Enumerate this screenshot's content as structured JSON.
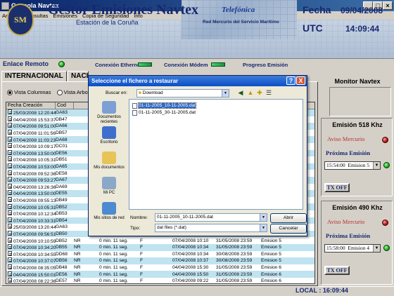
{
  "window": {
    "title": "Consola Navtex"
  },
  "menu": [
    "Archivo",
    "Consultas",
    "Emisiones",
    "Copia de Seguridad",
    "Info"
  ],
  "header": {
    "logo_text": "SM",
    "title": "Gestor Emisiones Navtex",
    "subtitle": "Estación de la Coruña",
    "brand": "Telefónica",
    "network": "Red Mercurio del Servicio Marítimo",
    "fecha_label": "Fecha",
    "fecha_value": "09/04/2008",
    "utc_label": "UTC",
    "utc_value": "14:09:44"
  },
  "status": {
    "enlace_label": "Enlace Remoto",
    "ethernet_label": "Conexión Ethernet",
    "modem_label": "Conexión Módem",
    "progreso_label": "Progreso Emisión"
  },
  "tabs": [
    "INTERNACIONAL",
    "NACI"
  ],
  "view": {
    "columns_label": "Vista Columnas",
    "tree_label": "Vista Arbol"
  },
  "table": {
    "headers": [
      "Fecha Creación",
      "Cod Nx"
    ],
    "rows": [
      [
        "25/03/2008 12:20:44",
        "GA63",
        "",
        "",
        "",
        "",
        "",
        ""
      ],
      [
        "04/04/2008 15:53:37",
        "DB47",
        "",
        "",
        "",
        "",
        "",
        ""
      ],
      [
        "07/04/2008 09:51:00",
        "DA66",
        "",
        "",
        "",
        "",
        "",
        ""
      ],
      [
        "07/04/2008 11:01:56",
        "DB57",
        "",
        "",
        "",
        "",
        "",
        ""
      ],
      [
        "07/04/2008 11:03:23",
        "DA68",
        "",
        "",
        "",
        "",
        "",
        ""
      ],
      [
        "07/04/2008 10:09:17",
        "DC01",
        "",
        "",
        "",
        "",
        "",
        ""
      ],
      [
        "07/04/2008 13:50:00",
        "DE56",
        "",
        "",
        "",
        "",
        "",
        ""
      ],
      [
        "07/04/2008 10:05:31",
        "DB51",
        "",
        "",
        "",
        "",
        "",
        ""
      ],
      [
        "07/04/2008 10:53:00",
        "DA65",
        "",
        "",
        "",
        "",
        "",
        ""
      ],
      [
        "07/04/2008 09:52:36",
        "DE58",
        "",
        "",
        "",
        "",
        "",
        ""
      ],
      [
        "07/04/2008 09:53:27",
        "DA67",
        "",
        "",
        "",
        "",
        "",
        ""
      ],
      [
        "04/04/2008 13:26:36",
        "DA69",
        "",
        "",
        "",
        "",
        "",
        ""
      ],
      [
        "04/04/2008 13:50:00",
        "DE55",
        "",
        "",
        "",
        "",
        "",
        ""
      ],
      [
        "07/04/2008 09:55:13",
        "DB49",
        "",
        "",
        "",
        "",
        "",
        ""
      ],
      [
        "07/04/2008 10:05:31",
        "DB52",
        "",
        "",
        "",
        "",
        "",
        ""
      ],
      [
        "07/04/2008 10:12:34",
        "DB53",
        "",
        "",
        "",
        "",
        "",
        ""
      ],
      [
        "07/04/2008 10:33:31",
        "DB54",
        "",
        "",
        "",
        "",
        "",
        ""
      ],
      [
        "25/03/2008 13:20:44",
        "GA63",
        "",
        "",
        "",
        "",
        "",
        ""
      ],
      [
        "07/04/2008 09:56:51",
        "DB50",
        "",
        "",
        "",
        "",
        "",
        ""
      ],
      [
        "07/04/2008 10:10:59",
        "DB52",
        "NR",
        "0 min. 11 seg.",
        "F",
        "07/04/2008 10:10",
        "31/05/2008 23:59",
        "Emision 5"
      ],
      [
        "07/04/2008 10:34:20",
        "DB55",
        "NR",
        "0 min. 11 seg.",
        "F",
        "07/04/2008 10:34",
        "31/05/2008 23:59",
        "Emision 5"
      ],
      [
        "07/04/2008 10:34:55",
        "DD68",
        "NR",
        "0 min. 11 seg.",
        "F",
        "07/04/2008 10:34",
        "30/08/2008 23:59",
        "Emision 5"
      ],
      [
        "07/04/2008 10:37:07",
        "DB56",
        "NR",
        "0 min. 11 seg.",
        "F",
        "07/04/2008 10:37",
        "30/08/2008 23:59",
        "Emision 5"
      ],
      [
        "07/04/2008 08:35:05",
        "DB48",
        "NR",
        "0 min. 11 seg.",
        "F",
        "04/04/2008 15:30",
        "31/05/2008 23:59",
        "Emision 6"
      ],
      [
        "04/04/2008 15:50:01",
        "DE56",
        "NR",
        "0 min. 11 seg.",
        "F",
        "04/04/2008 15:50",
        "31/05/2008 23:59",
        "Emision 6"
      ],
      [
        "07/04/2008 08:22:36",
        "DE57",
        "NR",
        "0 min. 11 seg.",
        "F",
        "07/04/2008 09:22",
        "31/05/2008 23:59",
        "Emision 6"
      ]
    ]
  },
  "right_panel": {
    "monitor_title": "Monitor Navtex",
    "g518": {
      "title": "Emisión 518 Khz",
      "aviso": "Aviso Mercurio",
      "prox": "Próxima Emisión",
      "time": "15:54:00",
      "emision": "Emision 5",
      "tx": "TX OFF"
    },
    "g490": {
      "title": "Emisión 490 Khz",
      "aviso": "Aviso Mercurio",
      "prox": "Próxima Emisión",
      "time": "15:58:00",
      "emision": "Emision 4",
      "tx": "TX OFF"
    }
  },
  "statusbar": {
    "local": "LOCAL :  16:09:44"
  },
  "dialog": {
    "title": "Seleccione el fichero a restaurar",
    "help_btn": "?",
    "close_btn": "X",
    "buscar_label": "Buscar en:",
    "buscar_value": "Download",
    "places": [
      "Documentos recientes",
      "Escritorio",
      "Mis documentos",
      "Mi PC",
      "Mis sitios de red"
    ],
    "files": [
      "01-11-2005_10-11-2005.dat",
      "01-11-2005_30-11-2005.dat"
    ],
    "nombre_label": "Nombre:",
    "nombre_value": "01-11-2005_10-11-2005.dat",
    "tipo_label": "Tipo:",
    "tipo_value": "dat files (*.dat)",
    "abrir": "Abrir",
    "cancelar": "Cancelar"
  },
  "colors": {
    "header_blue": "#16286e",
    "row_blue": "#bfe3f1",
    "aviso_red": "#b8312f"
  }
}
